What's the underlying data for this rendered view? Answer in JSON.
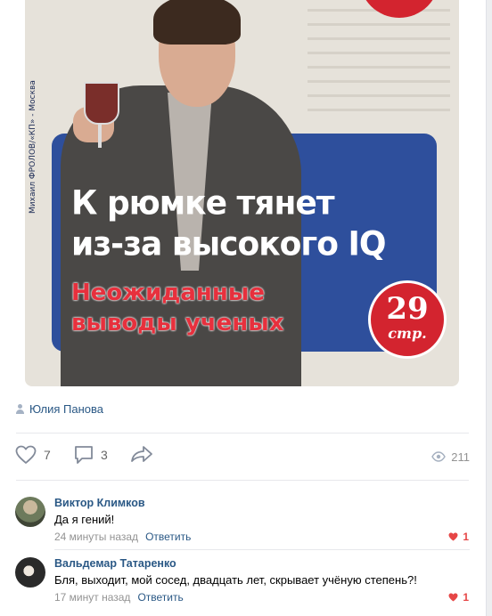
{
  "post": {
    "photo": {
      "headline_line1": "К рюмке тянет",
      "headline_line2": "из-за высокого IQ",
      "sub_line1": "Неожиданные",
      "sub_line2": "выводы ученых",
      "side_credit": "Михаил ФРОЛОВ/«КП» - Москва",
      "badge_number": "29",
      "badge_unit": "стр."
    },
    "author": {
      "name": "Юлия Панова",
      "icon": "user-icon"
    },
    "actions": {
      "likes": "7",
      "comments": "3",
      "views": "211",
      "like_icon": "heart-icon",
      "comment_icon": "comment-icon",
      "share_icon": "share-icon",
      "views_icon": "eye-icon"
    }
  },
  "comments": [
    {
      "name": "Виктор Климков",
      "text": "Да я гений!",
      "time": "24 минуты назад",
      "reply_label": "Ответить",
      "likes": "1"
    },
    {
      "name": "Вальдемар Татаренко",
      "text": "Бля, выходит, мой сосед, двадцать лет, скрывает учёную степень?!",
      "time": "17 минут назад",
      "reply_label": "Ответить",
      "likes": "1"
    }
  ],
  "colors": {
    "link": "#2a5885",
    "meta": "#939393",
    "like_red": "#e64646",
    "icon_gray": "#828a99",
    "panel_blue": "#2e4f9c",
    "badge_red": "#d3242f"
  }
}
